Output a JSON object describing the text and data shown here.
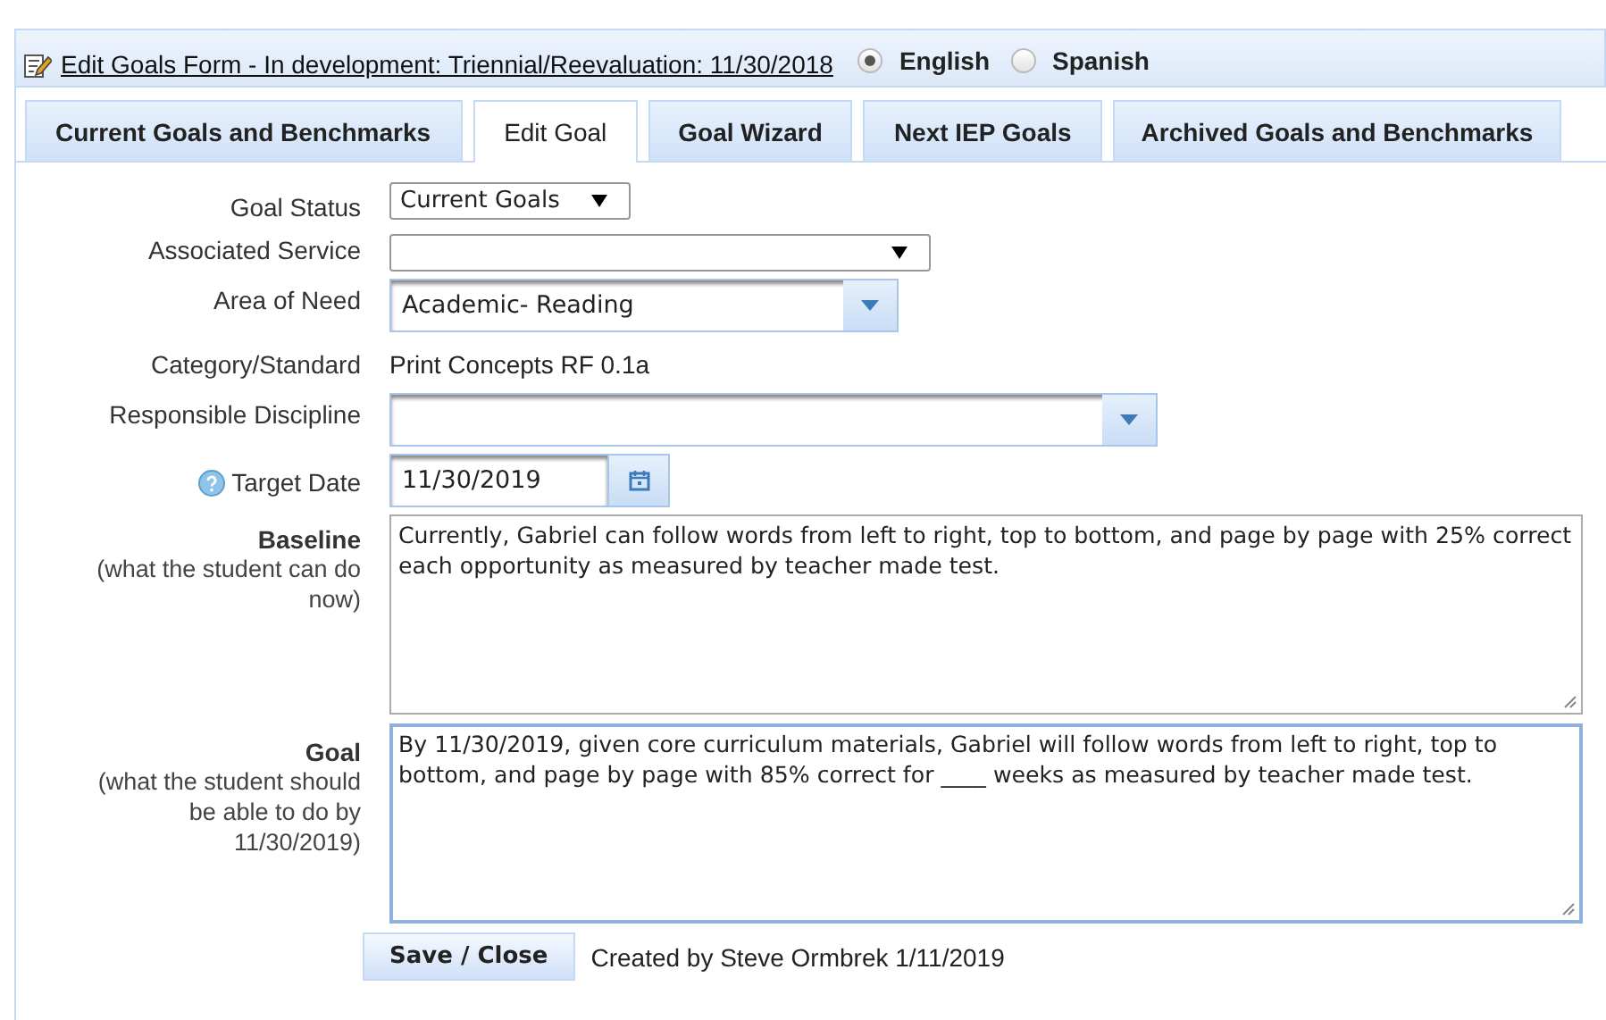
{
  "header": {
    "title": "Edit Goals Form - In development: Triennial/Reevaluation: 11/30/2018",
    "languages": [
      {
        "label": "English",
        "selected": true
      },
      {
        "label": "Spanish",
        "selected": false
      }
    ]
  },
  "tabs": [
    {
      "label": "Current Goals and Benchmarks",
      "selected": false
    },
    {
      "label": "Edit Goal",
      "selected": true
    },
    {
      "label": "Goal Wizard",
      "selected": false
    },
    {
      "label": "Next IEP Goals",
      "selected": false
    },
    {
      "label": "Archived Goals and Benchmarks",
      "selected": false
    }
  ],
  "fields": [
    {
      "kind": "select",
      "label": "Goal Status",
      "value": "Current Goals"
    },
    {
      "kind": "select",
      "label": "Associated Service"
    },
    {
      "kind": "combo",
      "label": "Area of Need",
      "value": "Academic- Reading"
    },
    {
      "kind": "text",
      "label": "Category/Standard",
      "value": "Print Concepts RF 0.1a"
    },
    {
      "kind": "combo",
      "label": "Responsible Discipline"
    },
    {
      "kind": "date",
      "label": "Target Date",
      "value": "11/30/2019",
      "help": true
    },
    {
      "kind": "textarea",
      "label": "Baseline",
      "note": "(what the student can do now)",
      "value": "Currently, Gabriel can follow words from left to right, top to bottom, and page by page with 25% correct each opportunity as measured by teacher made test.",
      "focused": false
    },
    {
      "kind": "textarea",
      "label": "Goal",
      "note": "(what the student should be able to do by 11/30/2019)",
      "value": "By 11/30/2019, given core curriculum materials, Gabriel will follow words from left to right, top to bottom, and page by page with 85% correct for ____ weeks as measured by teacher made test.",
      "focused": true
    }
  ],
  "footer": {
    "button": "Save / Close",
    "created": "Created by Steve Ormbrek 1/11/2019"
  }
}
